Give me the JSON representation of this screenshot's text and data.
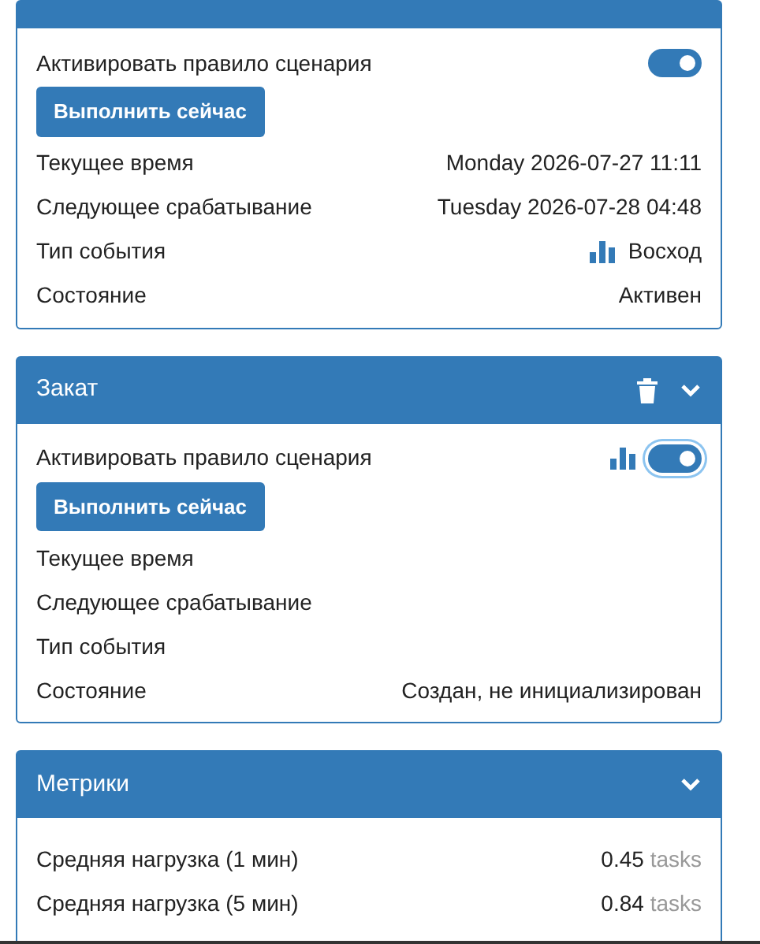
{
  "cards": [
    {
      "toggle": {
        "label": "Активировать правило сценария",
        "on": true,
        "focused": false,
        "icon": false
      },
      "run_button": "Выполнить сейчас",
      "rows": [
        {
          "label": "Текущее время",
          "value": "Monday 2026-07-27 11:11",
          "icon": false
        },
        {
          "label": "Следующее срабатывание",
          "value": "Tuesday 2026-07-28 04:48",
          "icon": false
        },
        {
          "label": "Тип события",
          "value": "Восход",
          "icon": true
        },
        {
          "label": "Состояние",
          "value": "Активен",
          "icon": false
        }
      ]
    },
    {
      "header": {
        "title": "Закат",
        "delete": true,
        "collapse": true
      },
      "toggle": {
        "label": "Активировать правило сценария",
        "on": true,
        "focused": true,
        "icon": true
      },
      "run_button": "Выполнить сейчас",
      "rows": [
        {
          "label": "Текущее время",
          "value": null,
          "icon": false
        },
        {
          "label": "Следующее срабатывание",
          "value": null,
          "icon": false
        },
        {
          "label": "Тип события",
          "value": null,
          "icon": false
        },
        {
          "label": "Состояние",
          "value": "Создан, не инициализирован",
          "icon": false
        }
      ]
    }
  ],
  "metrics": {
    "title": "Метрики",
    "collapse": true,
    "rows": [
      {
        "label": "Средняя нагрузка (1 мин)",
        "value": "0.45",
        "unit": "tasks"
      },
      {
        "label": "Средняя нагрузка (5 мин)",
        "value": "0.84",
        "unit": "tasks"
      }
    ]
  }
}
